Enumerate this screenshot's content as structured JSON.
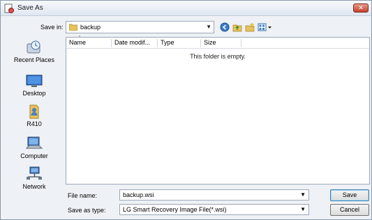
{
  "window": {
    "title": "Save As",
    "close_label": "✕"
  },
  "save_in": {
    "label": "Save in:",
    "value": "backup"
  },
  "toolbar": {
    "icons": [
      "back-icon",
      "up-folder-icon",
      "new-folder-icon",
      "views-icon"
    ]
  },
  "places": [
    {
      "label": "Recent Places",
      "icon": "recent-places-icon"
    },
    {
      "label": "Desktop",
      "icon": "desktop-icon"
    },
    {
      "label": "R410",
      "icon": "user-folder-icon"
    },
    {
      "label": "Computer",
      "icon": "computer-icon"
    },
    {
      "label": "Network",
      "icon": "network-icon"
    }
  ],
  "filelist": {
    "columns": [
      "Name",
      "Date modif...",
      "Type",
      "Size"
    ],
    "empty_message": "This folder is empty."
  },
  "file_name": {
    "label": "File name:",
    "value": "backup.wsi"
  },
  "save_as_type": {
    "label": "Save as type:",
    "value": "LG Smart Recovery Image File(*.wsi)"
  },
  "buttons": {
    "save": "Save",
    "cancel": "Cancel"
  },
  "colors": {
    "window_bg": "#eef1f5",
    "border": "#9aa7b8",
    "close_red": "#c4412b"
  }
}
